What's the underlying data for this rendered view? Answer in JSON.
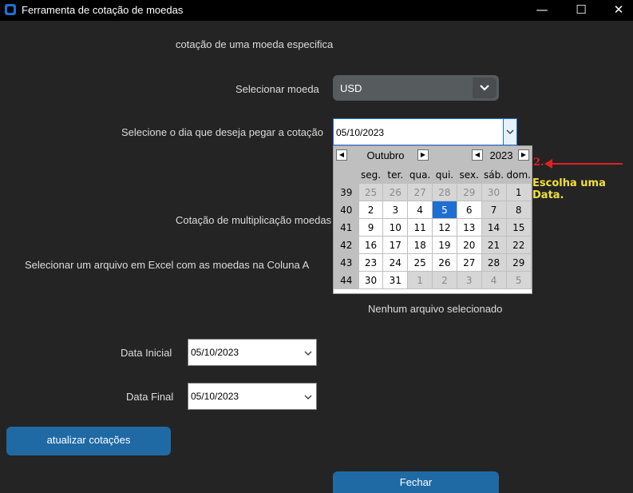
{
  "window": {
    "title": "Ferramenta de cotação de moedas",
    "minimize_glyph": "—",
    "maximize_glyph": "☐",
    "close_glyph": "✕"
  },
  "section_title": "cotação de uma moeda especifica",
  "currency": {
    "label": "Selecionar moeda",
    "value": "USD"
  },
  "date_pick": {
    "label": "Selecione o dia que deseja pegar a cotação",
    "value": "05/10/2023"
  },
  "calendar": {
    "month": "Outubro",
    "year": "2023",
    "weekdays": [
      "seg.",
      "ter.",
      "qua.",
      "qui.",
      "sex.",
      "sáb.",
      "dom."
    ],
    "weeks": [
      {
        "num": "39",
        "days": [
          "25",
          "26",
          "27",
          "28",
          "29",
          "30",
          "1"
        ],
        "other": [
          1,
          1,
          1,
          1,
          1,
          1,
          0
        ]
      },
      {
        "num": "40",
        "days": [
          "2",
          "3",
          "4",
          "5",
          "6",
          "7",
          "8"
        ],
        "other": [
          0,
          0,
          0,
          0,
          0,
          0,
          0
        ]
      },
      {
        "num": "41",
        "days": [
          "9",
          "10",
          "11",
          "12",
          "13",
          "14",
          "15"
        ],
        "other": [
          0,
          0,
          0,
          0,
          0,
          0,
          0
        ]
      },
      {
        "num": "42",
        "days": [
          "16",
          "17",
          "18",
          "19",
          "20",
          "21",
          "22"
        ],
        "other": [
          0,
          0,
          0,
          0,
          0,
          0,
          0
        ]
      },
      {
        "num": "43",
        "days": [
          "23",
          "24",
          "25",
          "26",
          "27",
          "28",
          "29"
        ],
        "other": [
          0,
          0,
          0,
          0,
          0,
          0,
          0
        ]
      },
      {
        "num": "44",
        "days": [
          "30",
          "31",
          "1",
          "2",
          "3",
          "4",
          "5"
        ],
        "other": [
          0,
          0,
          1,
          1,
          1,
          1,
          1
        ]
      }
    ],
    "selected_day": "5"
  },
  "annotation": {
    "number": "2.",
    "text": "Escolha uma Data.",
    "color": "#e02020",
    "text_color": "#f2e03a"
  },
  "multiplication_title": "Cotação de multiplicação moedas",
  "excel_label": "Selecionar um arquivo em Excel com as moedas na Coluna A",
  "file_status": "Nenhum arquivo selecionado",
  "start_date": {
    "label": "Data Inicial",
    "value": "05/10/2023"
  },
  "end_date": {
    "label": "Data Final",
    "value": "05/10/2023"
  },
  "update_button": "atualizar cotações",
  "close_button": "Fechar",
  "colors": {
    "background": "#242424",
    "accent": "#1f6aa5",
    "selected": "#1f6fd1"
  }
}
